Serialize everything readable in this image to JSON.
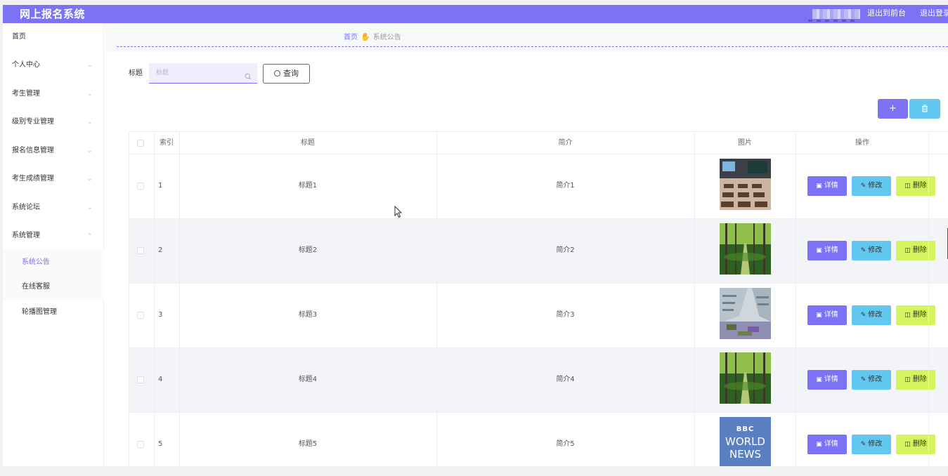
{
  "topbar": {
    "title": "网上报名系统",
    "front_link": "退出到前台",
    "logout_link": "退出登录"
  },
  "sidebar": {
    "items": [
      {
        "label": "首页"
      },
      {
        "label": "个人中心"
      },
      {
        "label": "考生管理"
      },
      {
        "label": "级别专业管理"
      },
      {
        "label": "报名信息管理"
      },
      {
        "label": "考生成绩管理"
      },
      {
        "label": "系统论坛"
      },
      {
        "label": "系统管理"
      }
    ],
    "subitems": [
      {
        "label": "系统公告"
      },
      {
        "label": "在线客服"
      },
      {
        "label": "轮播图管理"
      }
    ]
  },
  "breadcrumb": {
    "home": "首页",
    "current": "系统公告"
  },
  "search": {
    "label": "标题",
    "placeholder": "标题",
    "button": "查询"
  },
  "toolbar": {
    "add": "+",
    "delete_icon": "trash-icon"
  },
  "table": {
    "headers": [
      "索引",
      "标题",
      "简介",
      "图片",
      "操作"
    ],
    "rows": [
      {
        "index": "1",
        "title": "标题1",
        "intro": "简介1",
        "image": "classroom"
      },
      {
        "index": "2",
        "title": "标题2",
        "intro": "简介2",
        "image": "forest"
      },
      {
        "index": "3",
        "title": "标题3",
        "intro": "简介3",
        "image": "building"
      },
      {
        "index": "4",
        "title": "标题4",
        "intro": "简介4",
        "image": "forest"
      },
      {
        "index": "5",
        "title": "标题5",
        "intro": "简介5",
        "image": "bbc"
      }
    ],
    "actions": {
      "detail": "详情",
      "edit": "修改",
      "delete": "删除"
    }
  },
  "bbc_logo": {
    "line1": "BBC",
    "line2": "WORLD",
    "line3": "NEWS"
  },
  "colors": {
    "primary": "#7b72f5",
    "info": "#62c8f0",
    "lime": "#d5f35e"
  }
}
